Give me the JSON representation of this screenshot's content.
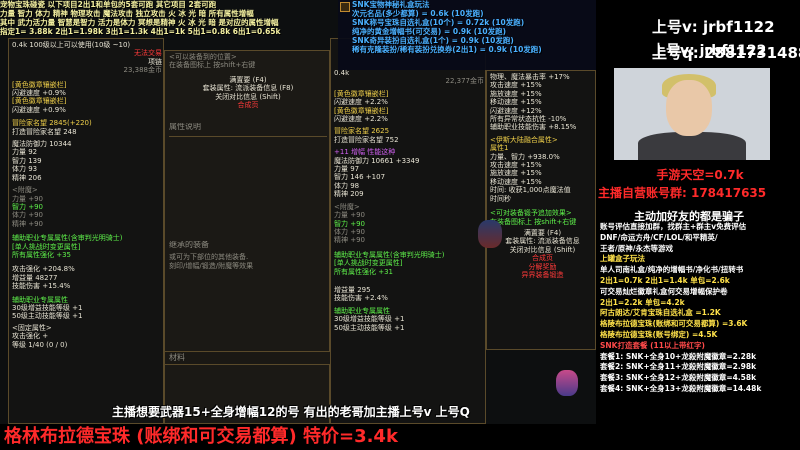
{
  "top_left": {
    "rows": [
      "宠物宝珠碰瓷  以下项目2出1和单包的5套可跑  其它项目 2套可跑",
      "力量 智力 体力 精神 物理攻击 魔法攻击 独立攻击 火 冰 光 暗 所有属性增幅",
      "其中 武力活力量 智慧是智力 活力是体力 冥想是精神 火 冰 光 暗 是对应的属性增幅",
      "指定1= 3.88k 2出1=1.98k 3出1=1.3k 4出1=1k 5出1=0.8k 6出1=0.65k"
    ]
  },
  "left_panel": {
    "lines": [
      "0.4k  100级以上可以使用(10级 ~10)",
      "无法交易",
      "项链",
      "23,388金币",
      "[黄色徽章镶嵌栏]",
      "闪避速度 +0.9%",
      "[黄色徽章镶嵌栏]",
      "闪避速度 +0.9%",
      "冒险家名望 2845(+220)",
      "打造冒险家名望 248",
      "魔法防御力 10344",
      "力量 92",
      "智力 139",
      "体力 93",
      "精神 206",
      "<附魔>",
      "力量 +90",
      "智力 +90",
      "体力 +90",
      "精神 +90",
      "辅助职业专属属性(含审判光明骑士)",
      "[单人挑战时变更属性]",
      "所有属性强化 +35",
      "攻击强化 +204.8%",
      "增益量 48277",
      "技能伤害 +15.4%",
      "辅助职业专属属性",
      "30级增益技能等级 +1",
      "50级主动技能等级 +1",
      "<固定属性>",
      "攻击强化 +",
      "等级 1/40 (0 / 0)"
    ]
  },
  "mid_panel": {
    "lines": [
      "<可以装备到的位置>",
      "在装备图标上 按shift+右键",
      "满置要 (F4)",
      "套装属性: 流派装备信息 (F8)",
      "关闭对比信息 (Shift)",
      "合成页"
    ],
    "tab_label": "属性说明",
    "inherit_title": "继承的装备",
    "inherit_lines": [
      "或可为下部位的其他装备.",
      "刻印/增幅/锻造/附魔等效果"
    ],
    "material_label": "材料"
  },
  "right_game_panel": {
    "title_lines": [
      "SNK宝物神秘礼盒玩法",
      "次元名品(多少都算) = 0.6k (10发跑)",
      "SNK称号宝珠自选礼盒(10个) = 0.72k (10发跑)",
      "纯净的黄金增幅书(可交易) = 0.9k (10发跑)",
      "SNK奇异装扮自选礼盒(1个) = 0.9k (10发跑)",
      "稀有克隆装扮/稀有装扮兑换券(2出1) = 0.9k (10发跑)"
    ],
    "lines": [
      "0.4k",
      "22,377金币",
      "[黄色徽章镶嵌栏]",
      "闪避速度 +2.2%",
      "[黄色徽章镶嵌栏]",
      "闪避速度 +2.2%",
      "冒险家名望 2625",
      "打造冒险家名望 752",
      "+11 增幅  性能这种",
      "魔法防御力 10661 +3349",
      "力量 97",
      "智力 146 +107",
      "体力 98",
      "精神 209",
      "<附魔>",
      "力量 +90",
      "智力 +90",
      "体力 +90",
      "精神 +90",
      "辅助职业专属属性(含审判光明骑士)",
      "[单人挑战时变更属性]",
      "所有属性强化 +31",
      "增益量 295",
      "技能伤害 +2.4%",
      "辅助职业专属属性",
      "30级增益技能等级 +1",
      "50级主动技能等级 +1"
    ]
  },
  "tooltip3": {
    "lines": [
      "物理、魔法暴击率 +17%",
      "攻击速度 +15%",
      "施放速度 +15%",
      "移动速度 +15%",
      "闪避速度 +12%",
      "所有异常状态抗性 -10%",
      "辅助职业技能伤害 +8.15%",
      "<伊斯大陆融合属性>",
      "属性1",
      "力量、智力 +938.0%",
      "攻击速度 +15%",
      "施放速度 +15%",
      "移动速度 +15%",
      "时间: 收获1,000点魔法值",
      "时间秒",
      "<可对装备锻予追加效果>",
      "在装备图标上 按shift+右键",
      "满置要 (F4)",
      "套装属性: 流派装备信息",
      "关闭对比信息 (Shift)",
      "合成页",
      "分解奖励",
      "异界装备锻造"
    ]
  },
  "bottom_sub": "主播想要武器15+全身增幅12的号  有出的老哥加主播上号v   上号Q",
  "bottom_banner": "格林布拉德宝珠 (账绑和可交易都算) 特价=3.4k",
  "right_column": {
    "header1": "上号v: jrbf1122",
    "header2": "上号q: 2881731488",
    "sky": "手游天空=0.7k",
    "official": "主播自营账号群: 178417635",
    "warn": "主动加好友的都是骗子",
    "lines": [
      "账号评估直接加群，找群主+群主v免费评估",
      "",
      "DNF/命运方舟/CF/LOL/和平精英/",
      "",
      "王者/原神/永杰等游戏",
      "上罐盒子玩法",
      "单人司南礼盒/纯净的增幅书/净化书/扭转书",
      "2出1=0.7k   2出1=1.4k   单包=2.6k",
      "可交易灿烂徽章礼盒何交易增幅保护卷",
      "2出1=2.2k   单包=4.2k",
      "阿古朗达/艾肯宝珠自选礼盒 =1.2K",
      "格陵布拉德宝珠(账绑和可交易都算) =3.6K",
      "格陵布拉德宝珠(账号绑定) =4.5K",
      "",
      "SNK打造套餐 (11以上带红字)",
      "套餐1: SNK+全身10+龙殺附魔徽章=2.28k",
      "套餐2: SNK+全身11+龙殺附魔徽章=2.98k",
      "套餐3: SNK+全身12+龙殺附魔徽章=4.58k",
      "套餐4: SNK+全身13+龙殺附魔徽章=14.48k"
    ]
  }
}
